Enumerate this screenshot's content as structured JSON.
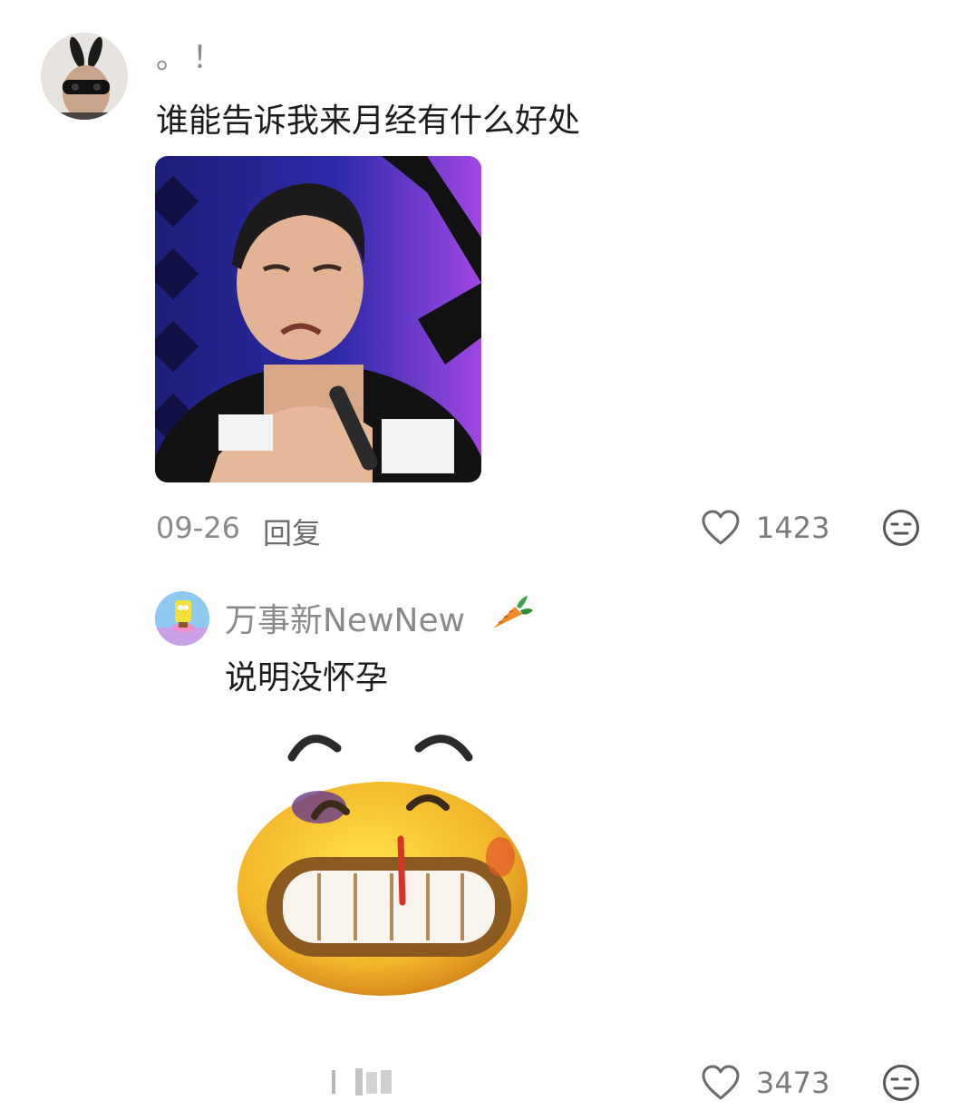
{
  "comments": [
    {
      "username": "。！",
      "text": "谁能告诉我来月经有什么好处",
      "date": "09-26",
      "reply_label": "回复",
      "likes": "1423",
      "icons": [
        "avatar",
        "photo",
        "heart-outline-icon",
        "meh-face-icon"
      ]
    },
    {
      "username": "万事新NewNew",
      "username_icon": "carrot-icon",
      "text": "说明没怀孕",
      "likes": "3473",
      "icons": [
        "avatar",
        "sticker",
        "heart-outline-icon",
        "meh-face-icon"
      ]
    }
  ],
  "colors": {
    "primary_text": "#1c1c1c",
    "secondary_text": "#8a8a8a",
    "icon_stroke": "#6b6b6b"
  }
}
